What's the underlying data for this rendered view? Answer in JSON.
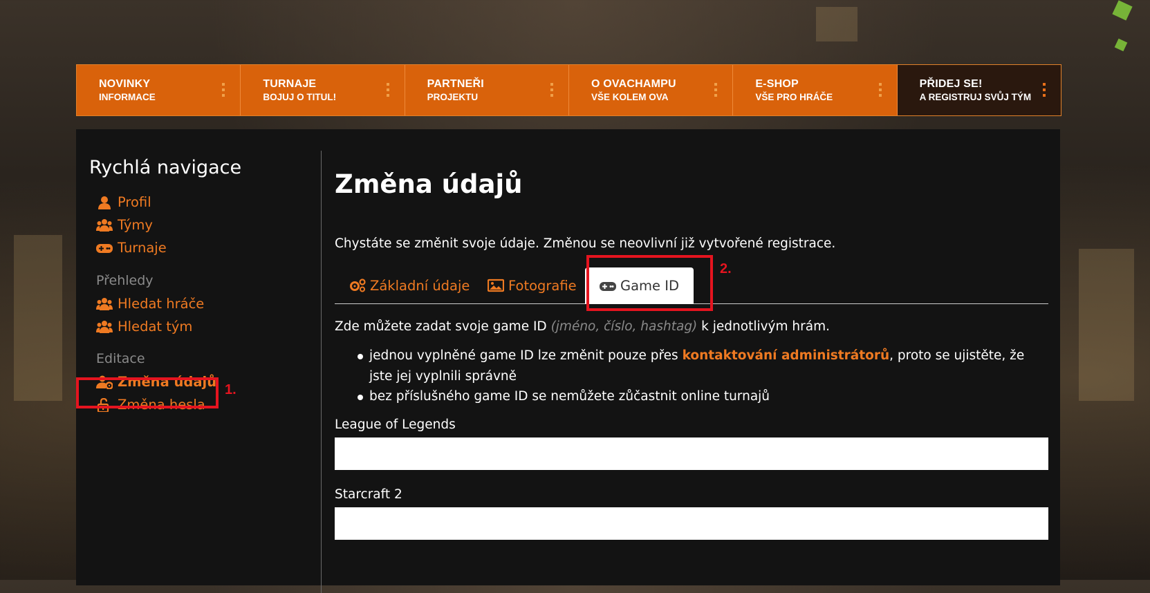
{
  "nav": [
    {
      "title": "NOVINKY",
      "subtitle": "INFORMACE"
    },
    {
      "title": "TURNAJE",
      "subtitle": "BOJUJ O TITUL!"
    },
    {
      "title": "PARTNEŘI",
      "subtitle": "PROJEKTU"
    },
    {
      "title": "O OVACHAMPU",
      "subtitle": "VŠE KOLEM OVA"
    },
    {
      "title": "E-SHOP",
      "subtitle": "VŠE PRO HRÁČE"
    },
    {
      "title": "PŘIDEJ SE!",
      "subtitle": "A REGISTRUJ SVŮJ TÝM"
    }
  ],
  "sidebar": {
    "title": "Rychlá navigace",
    "links_main": [
      {
        "label": "Profil",
        "icon": "user-icon"
      },
      {
        "label": "Týmy",
        "icon": "users-icon"
      },
      {
        "label": "Turnaje",
        "icon": "gamepad-icon"
      }
    ],
    "section_overview": "Přehledy",
    "links_overview": [
      {
        "label": "Hledat hráče",
        "icon": "users-icon"
      },
      {
        "label": "Hledat tým",
        "icon": "users-icon"
      }
    ],
    "section_edit": "Editace",
    "links_edit": [
      {
        "label": "Změna údajů",
        "icon": "user-cog-icon",
        "active": true
      },
      {
        "label": "Změna hesla",
        "icon": "unlock-icon"
      }
    ]
  },
  "annotations": {
    "step1": "1.",
    "step2": "2."
  },
  "content": {
    "title": "Změna údajů",
    "intro": "Chystáte se změnit svoje údaje. Změnou se neovlivní již vytvořené registrace.",
    "tabs": [
      {
        "label": "Základní údaje",
        "icon": "cogs-icon"
      },
      {
        "label": "Fotografie",
        "icon": "image-icon"
      },
      {
        "label": "Game ID",
        "icon": "gamepad-icon",
        "active": true
      }
    ],
    "desc_prefix": "Zde můžete zadat svoje game ID",
    "desc_hint": "(jméno, číslo, hashtag)",
    "desc_suffix": "k jednotlivým hrám.",
    "bullet1_prefix": "jednou vyplněné game ID lze změnit pouze přes",
    "bullet1_link": "kontaktování administrátorů",
    "bullet1_suffix": ", proto se ujistěte, že jste jej vyplnili správně",
    "bullet2": "bez příslušného game ID se nemůžete zůčastnit online turnajů",
    "fields": [
      {
        "label": "League of Legends",
        "value": ""
      },
      {
        "label": "Starcraft 2",
        "value": ""
      }
    ]
  }
}
